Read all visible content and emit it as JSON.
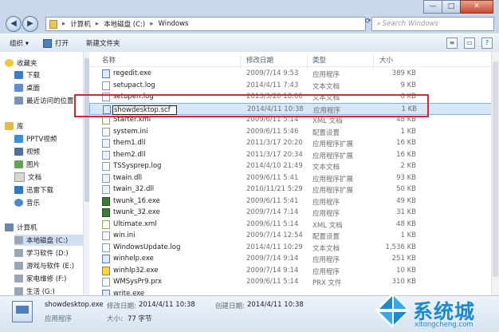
{
  "titlebar": {
    "minimize": "—",
    "maximize": "□",
    "close": "✕"
  },
  "address": {
    "segments": [
      "计算机",
      "本地磁盘 (C:)",
      "Windows"
    ],
    "placeholder": "Search Windows"
  },
  "toolbar": {
    "organize": "组织 ▾",
    "open": "打开",
    "new_folder": "新建文件夹"
  },
  "sidebar": {
    "favorites": "收藏夹",
    "favorite_items": [
      "下载",
      "桌面",
      "最近访问的位置"
    ],
    "libraries": "库",
    "library_items": [
      "PPTV视频",
      "视频",
      "图片",
      "文档",
      "迅雷下载",
      "音乐"
    ],
    "computer": "计算机",
    "drives": [
      "本地磁盘 (C:)",
      "学习软件 (D:)",
      "游戏与软件 (E:)",
      "家电维修 (F:)",
      "生活 (G:)"
    ]
  },
  "columns": {
    "name": "名称",
    "date": "修改日期",
    "type": "类型",
    "size": "大小"
  },
  "files": [
    {
      "name": "regedit.exe",
      "date": "2009/7/14 9:53",
      "type": "应用程序",
      "size": "389 KB",
      "icon": "exe"
    },
    {
      "name": "setupact.log",
      "date": "2014/4/11 7:43",
      "type": "文本文档",
      "size": "9 KB",
      "icon": "log"
    },
    {
      "name": "setuperr.log",
      "date": "2013/3/20 18:00",
      "type": "文本文档",
      "size": "0 KB",
      "icon": "log"
    },
    {
      "name": "showdesktop.scf",
      "date": "2014/4/11 10:38",
      "type": "应用程序",
      "size": "1 KB",
      "icon": "exe"
    },
    {
      "name": "Starter.xml",
      "date": "2009/6/11 5:14",
      "type": "XML 文档",
      "size": "48 KB",
      "icon": "xml"
    },
    {
      "name": "system.ini",
      "date": "2009/6/11 5:46",
      "type": "配置设置",
      "size": "1 KB",
      "icon": "ini"
    },
    {
      "name": "them1.dll",
      "date": "2011/3/17 20:20",
      "type": "应用程序扩展",
      "size": "16 KB",
      "icon": "dll"
    },
    {
      "name": "them2.dll",
      "date": "2011/3/17 20:34",
      "type": "应用程序扩展",
      "size": "16 KB",
      "icon": "dll"
    },
    {
      "name": "TSSysprep.log",
      "date": "2014/4/10 21:49",
      "type": "文本文档",
      "size": "2 KB",
      "icon": "log"
    },
    {
      "name": "twain.dll",
      "date": "2009/6/11 5:41",
      "type": "应用程序扩展",
      "size": "93 KB",
      "icon": "dll"
    },
    {
      "name": "twain_32.dll",
      "date": "2010/11/21 5:29",
      "type": "应用程序扩展",
      "size": "50 KB",
      "icon": "dll"
    },
    {
      "name": "twunk_16.exe",
      "date": "2009/6/11 5:41",
      "type": "应用程序",
      "size": "49 KB",
      "icon": "green"
    },
    {
      "name": "twunk_32.exe",
      "date": "2009/7/14 7:14",
      "type": "应用程序",
      "size": "31 KB",
      "icon": "green"
    },
    {
      "name": "Ultimate.xml",
      "date": "2009/6/11 5:14",
      "type": "XML 文档",
      "size": "48 KB",
      "icon": "xml"
    },
    {
      "name": "win.ini",
      "date": "2009/7/14 12:54",
      "type": "配置设置",
      "size": "1 KB",
      "icon": "ini"
    },
    {
      "name": "WindowsUpdate.log",
      "date": "2014/4/11 10:29",
      "type": "文本文档",
      "size": "1,536 KB",
      "icon": "log"
    },
    {
      "name": "winhelp.exe",
      "date": "2009/7/14 9:14",
      "type": "应用程序",
      "size": "251 KB",
      "icon": "exe"
    },
    {
      "name": "winhlp32.exe",
      "date": "2009/7/14 9:14",
      "type": "应用程序",
      "size": "10 KB",
      "icon": "help"
    },
    {
      "name": "WMSysPr9.prx",
      "date": "2009/6/11 5:14",
      "type": "PRX 文件",
      "size": "310 KB",
      "icon": "log"
    },
    {
      "name": "write.exe",
      "date": "",
      "type": "",
      "size": "",
      "icon": "exe"
    }
  ],
  "rename_text": "showdesktop.scf",
  "status": {
    "filename": "showdesktop.exe",
    "modified_label": "修改日期:",
    "modified": "2014/4/11 10:38",
    "created_label": "创建日期:",
    "created": "2014/4/11 10:38",
    "type": "应用程序",
    "size_label": "大小:",
    "size": "77 字节"
  },
  "watermark": {
    "brand": "系统城",
    "url": "xitongcheng.com"
  },
  "colors": {
    "highlight": "#d9262c",
    "selection": "#d7e7fa",
    "brand": "#1b8ad1"
  }
}
